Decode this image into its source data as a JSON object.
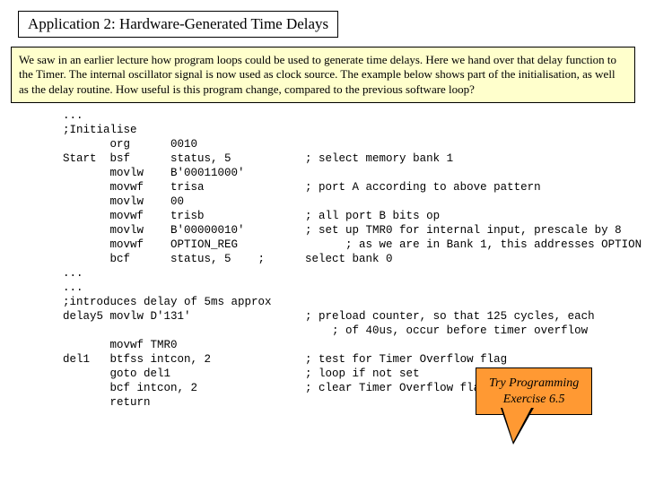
{
  "title": "Application 2: Hardware-Generated Time Delays",
  "description": "We saw in an earlier lecture how program loops could be used to generate time delays. Here we hand over that delay function to the Timer. The internal oscillator signal is now used as clock source. The example below shows part of the initialisation, as well as the delay routine. How useful is this program change, compared to the previous software loop?",
  "code": "...\n;Initialise\n       org      0010\nStart  bsf      status, 5           ; select memory bank 1\n       movlw    B'00011000'\n       movwf    trisa               ; port A according to above pattern\n       movlw    00\n       movwf    trisb               ; all port B bits op\n       movlw    B'00000010'         ; set up TMR0 for internal input, prescale by 8\n       movwf    OPTION_REG                ; as we are in Bank 1, this addresses OPTION\n       bcf      status, 5    ;      select bank 0\n...\n...\n;introduces delay of 5ms approx\ndelay5 movlw D'131'                 ; preload counter, so that 125 cycles, each\n                                        ; of 40us, occur before timer overflow\n       movwf TMR0\ndel1   btfss intcon, 2              ; test for Timer Overflow flag\n       goto del1                    ; loop if not set\n       bcf intcon, 2                ; clear Timer Overflow flag\n       return",
  "callout": {
    "line1": "Try Programming",
    "line2": "Exercise 6.5"
  }
}
